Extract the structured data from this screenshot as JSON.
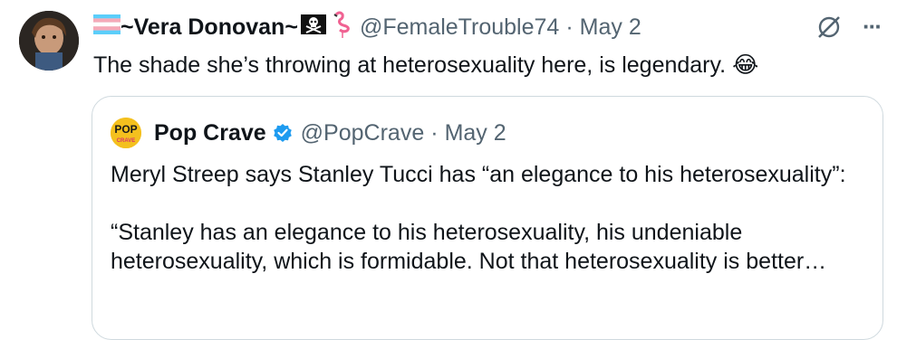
{
  "tweet": {
    "author_name": "~Vera Donovan~",
    "handle": "@FemaleTrouble74",
    "separator": "·",
    "date": "May 2",
    "text": "The shade she’s throwing at heterosexuality here, is legendary.",
    "emoji_text": "😂",
    "name_icons": [
      "transgender-flag-icon",
      "skull-crossbones-flag-icon",
      "flamingo-icon"
    ]
  },
  "actions": {
    "icons": [
      "grok-icon",
      "more-icon"
    ],
    "more_glyph": "···"
  },
  "quoted": {
    "author_name": "Pop Crave",
    "handle": "@PopCrave",
    "separator": "·",
    "date": "May 2",
    "verified": true,
    "avatar_text": "POP",
    "avatar_subtext": "CRAVE",
    "avatar_color": "#f4c01e",
    "text_line1": "Meryl Streep says Stanley Tucci has “an elegance to his heterosexuality”:",
    "text_line2": "“Stanley has an elegance to his heterosexuality, his undeniable heterosexuality, which is formidable. Not that heterosexuality is better…"
  },
  "colors": {
    "text": "#0f1419",
    "secondary": "#536471",
    "verified": "#1d9bf0",
    "border": "#cfd9de"
  }
}
